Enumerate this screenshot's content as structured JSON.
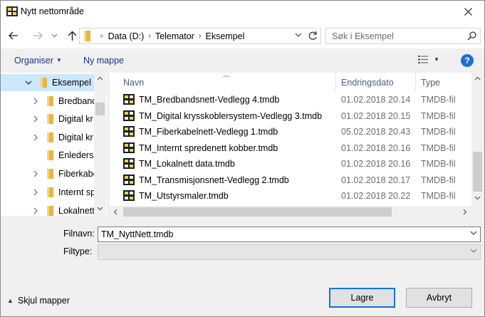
{
  "window": {
    "title": "Nytt nettområde"
  },
  "nav": {
    "breadcrumbs": [
      "Data (D:)",
      "Telemator",
      "Eksempel"
    ],
    "search_placeholder": "Søk i Eksempel"
  },
  "toolbar": {
    "organize_label": "Organiser",
    "new_folder_label": "Ny mappe"
  },
  "tree": {
    "items": [
      {
        "label": "Eksempel",
        "expanded": true,
        "selected": true
      },
      {
        "label": "Bredband"
      },
      {
        "label": "Digital kr"
      },
      {
        "label": "Digital kr"
      },
      {
        "label": "Enlederss"
      },
      {
        "label": "Fiberkabe"
      },
      {
        "label": "Internt sp"
      },
      {
        "label": "Lokalnett"
      }
    ]
  },
  "files": {
    "columns": {
      "name": "Navn",
      "date": "Endringsdato",
      "type": "Type"
    },
    "rows": [
      {
        "name": "TM_Bredbandsnett-Vedlegg 4.tmdb",
        "date": "01.02.2018 20.14",
        "type": "TMDB-fil"
      },
      {
        "name": "TM_Digital krysskoblersystem-Vedlegg 3.tmdb",
        "date": "01.02.2018 20.15",
        "type": "TMDB-fil"
      },
      {
        "name": "TM_Fiberkabelnett-Vedlegg 1.tmdb",
        "date": "05.02.2018 20.43",
        "type": "TMDB-fil"
      },
      {
        "name": "TM_Internt spredenett kobber.tmdb",
        "date": "01.02.2018 20.16",
        "type": "TMDB-fil"
      },
      {
        "name": "TM_Lokalnett data.tmdb",
        "date": "01.02.2018 20.16",
        "type": "TMDB-fil"
      },
      {
        "name": "TM_Transmisjonsnett-Vedlegg 2.tmdb",
        "date": "01.02.2018 20.17",
        "type": "TMDB-fil"
      },
      {
        "name": "TM_Utstyrsmaler.tmdb",
        "date": "01.02.2018 20.22",
        "type": "TMDB-fil"
      }
    ]
  },
  "form": {
    "filename_label": "Filnavn:",
    "filename_value": "TM_NyttNett.tmdb",
    "filetype_label": "Filtype:",
    "filetype_value": ""
  },
  "footer": {
    "hide_folders_label": "Skjul mapper",
    "save_label": "Lagre",
    "cancel_label": "Avbryt"
  },
  "colors": {
    "accent": "#0078d7",
    "selection": "#cce8ff",
    "folder": "#e8b540",
    "link": "#1e3287",
    "help": "#1f6fd1"
  },
  "icons": [
    "app-icon",
    "close-icon",
    "back-arrow-icon",
    "forward-arrow-icon",
    "chevron-down-icon",
    "up-arrow-icon",
    "folder-icon",
    "refresh-icon",
    "search-icon",
    "view-details-icon",
    "help-icon",
    "tmdb-file-icon"
  ]
}
